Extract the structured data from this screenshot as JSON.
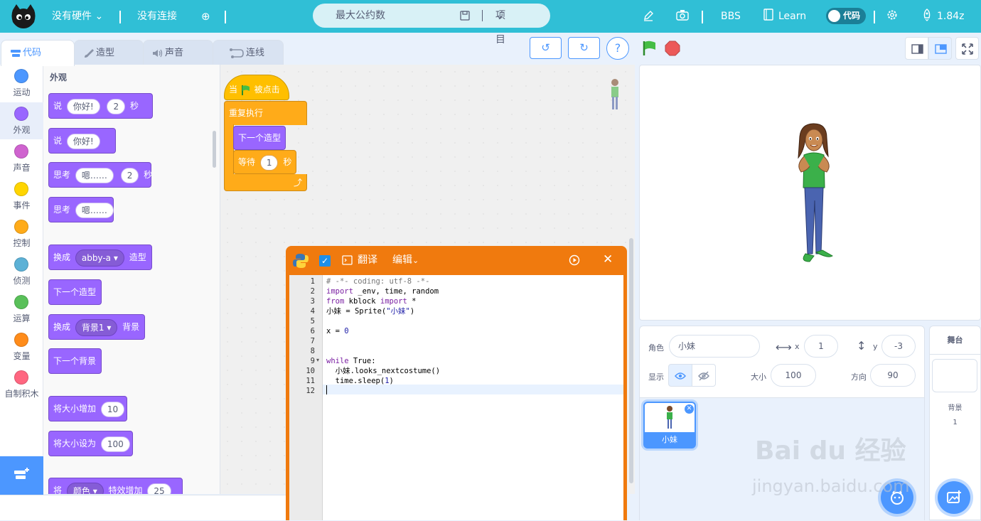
{
  "topbar": {
    "hardware": "没有硬件",
    "connection": "没有连接",
    "project_name": "最大公约数",
    "project_menu": "项目",
    "bbs": "BBS",
    "learn": "Learn",
    "code_toggle": "代码",
    "version": "1.84z"
  },
  "tabs": [
    "代码",
    "造型",
    "声音",
    "连线"
  ],
  "categories": [
    {
      "label": "运动",
      "color": "#4c97ff"
    },
    {
      "label": "外观",
      "color": "#9966ff"
    },
    {
      "label": "声音",
      "color": "#cf63cf"
    },
    {
      "label": "事件",
      "color": "#ffd500"
    },
    {
      "label": "控制",
      "color": "#ffab19"
    },
    {
      "label": "侦测",
      "color": "#5cb1d6"
    },
    {
      "label": "运算",
      "color": "#59c059"
    },
    {
      "label": "变量",
      "color": "#ff8c1a"
    },
    {
      "label": "自制积木",
      "color": "#ff6680"
    }
  ],
  "palette": {
    "heading": "外观",
    "say_secs": {
      "say": "说",
      "text": "你好!",
      "secs": "2",
      "unit": "秒"
    },
    "say": {
      "say": "说",
      "text": "你好!"
    },
    "think_secs": {
      "think": "思考",
      "text": "嗯……",
      "secs": "2",
      "unit": "秒"
    },
    "think": {
      "think": "思考",
      "text": "嗯……"
    },
    "switch_costume": {
      "pre": "换成",
      "value": "abby-a",
      "post": "造型"
    },
    "next_costume": "下一个造型",
    "switch_backdrop": {
      "pre": "换成",
      "value": "背景1",
      "post": "背景"
    },
    "next_backdrop": "下一个背景",
    "change_size": {
      "label": "将大小增加",
      "value": "10"
    },
    "set_size": {
      "label": "将大小设为",
      "value": "100"
    },
    "change_effect": {
      "pre": "将",
      "value": "颜色",
      "post": "特效增加",
      "num": "25"
    }
  },
  "script": {
    "hat_when": "当",
    "hat_clicked": "被点击",
    "forever": "重复执行",
    "next_costume": "下一个造型",
    "wait": "等待",
    "wait_value": "1",
    "wait_unit": "秒"
  },
  "python": {
    "translate": "翻译",
    "edit": "编辑",
    "line_numbers": [
      "1",
      "2",
      "3",
      "4",
      "5",
      "6",
      "7",
      "8",
      "9",
      "10",
      "11",
      "12"
    ]
  },
  "sprite": {
    "label_sprite": "角色",
    "name": "小妹",
    "x_label": "x",
    "x": "1",
    "y_label": "y",
    "y": "-3",
    "show_label": "显示",
    "size_label": "大小",
    "size": "100",
    "dir_label": "方向",
    "dir": "90",
    "thumb_name": "小妹"
  },
  "stage_panel": {
    "title": "舞台",
    "backdrops_label": "背景",
    "backdrops_count": "1"
  },
  "watermark": {
    "logo": "Bai du 经验",
    "url": "jingyan.baidu.com"
  }
}
